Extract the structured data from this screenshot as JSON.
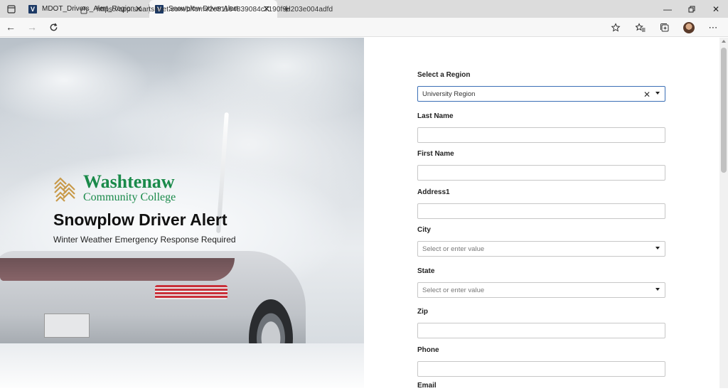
{
  "browser": {
    "tabs": [
      {
        "title": "MDOT_Drivers_Alert_Region - Sm",
        "favicon": "smartsheet-icon",
        "active": false
      },
      {
        "title": "Snowplow Driver Alert",
        "favicon": "smartsheet-icon",
        "active": true
      }
    ],
    "new_tab_label": "+",
    "url": "https://app.smartsheet.com/b/form/2e81164839084c7190f9d203e004adfd",
    "favicon_letter": "V"
  },
  "hero": {
    "logo_line1": "Washtenaw",
    "logo_line2": "Community College",
    "title": "Snowplow Driver Alert",
    "subtitle": "Winter Weather Emergency Response Required",
    "logo_color": "#1a8a4a"
  },
  "form": {
    "fields": [
      {
        "label": "Select a Region",
        "type": "select",
        "value": "University Region",
        "placeholder": "",
        "focused": true
      },
      {
        "label": "Last Name",
        "type": "text",
        "value": "",
        "placeholder": ""
      },
      {
        "label": "First Name",
        "type": "text",
        "value": "",
        "placeholder": ""
      },
      {
        "label": "Address1",
        "type": "text",
        "value": "",
        "placeholder": ""
      },
      {
        "label": "City",
        "type": "select",
        "value": "",
        "placeholder": "Select or enter value"
      },
      {
        "label": "State",
        "type": "select",
        "value": "",
        "placeholder": "Select or enter value"
      },
      {
        "label": "Zip",
        "type": "text",
        "value": "",
        "placeholder": ""
      },
      {
        "label": "Phone",
        "type": "text",
        "value": "",
        "placeholder": ""
      },
      {
        "label": "Email",
        "type": "text",
        "value": "",
        "placeholder": ""
      }
    ],
    "focus_color": "#3b6fb6"
  }
}
